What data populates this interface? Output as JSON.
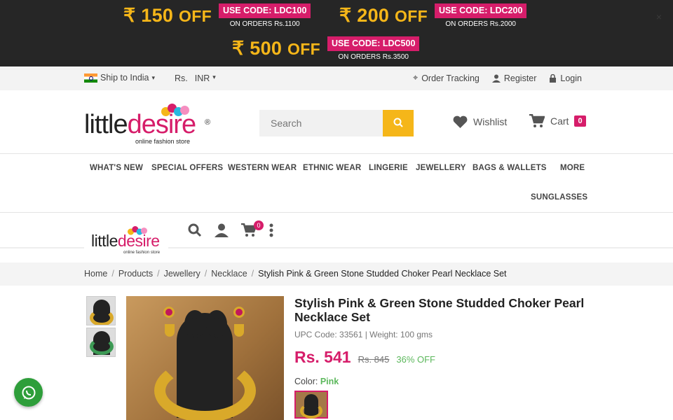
{
  "promo": {
    "offers": [
      {
        "amount": "₹ 150",
        "off": "OFF",
        "code": "USE CODE: LDC100",
        "min": "ON ORDERS Rs.1100"
      },
      {
        "amount": "₹ 200",
        "off": "OFF",
        "code": "USE CODE: LDC200",
        "min": "ON ORDERS Rs.2000"
      },
      {
        "amount": "₹ 500",
        "off": "OFF",
        "code": "USE CODE: LDC500",
        "min": "ON ORDERS Rs.3500"
      }
    ]
  },
  "topbar": {
    "ship_to": "Ship to India",
    "currency_symbol": "Rs.",
    "currency": "INR",
    "order_tracking": "Order Tracking",
    "register": "Register",
    "login": "Login"
  },
  "header": {
    "logo_word_a": "little",
    "logo_word_b": "desire",
    "logo_tag": "online fashion store",
    "reg": "®",
    "search_placeholder": "Search",
    "wishlist": "Wishlist",
    "cart": "Cart",
    "cart_count": "0"
  },
  "nav": {
    "items": [
      "WHAT'S NEW",
      "SPECIAL OFFERS",
      "WESTERN WEAR",
      "ETHNIC WEAR",
      "LINGERIE",
      "JEWELLERY",
      "BAGS & WALLETS",
      "MORE",
      "SUNGLASSES"
    ]
  },
  "sticky": {
    "cart_count": "0"
  },
  "breadcrumb": [
    "Home",
    "Products",
    "Jewellery",
    "Necklace",
    "Stylish Pink & Green Stone Studded Choker Pearl Necklace Set"
  ],
  "product": {
    "title": "Stylish Pink & Green Stone Studded Choker Pearl Necklace Set",
    "meta": "UPC Code: 33561 | Weight: 100 gms",
    "price": "Rs. 541",
    "mrp": "Rs. 845",
    "discount": "36% OFF",
    "color_label": "Color:",
    "color_value": "Pink"
  },
  "colors": {
    "accent": "#d61d6a",
    "promo_amount": "#f5b619",
    "green": "#5cb85c"
  }
}
